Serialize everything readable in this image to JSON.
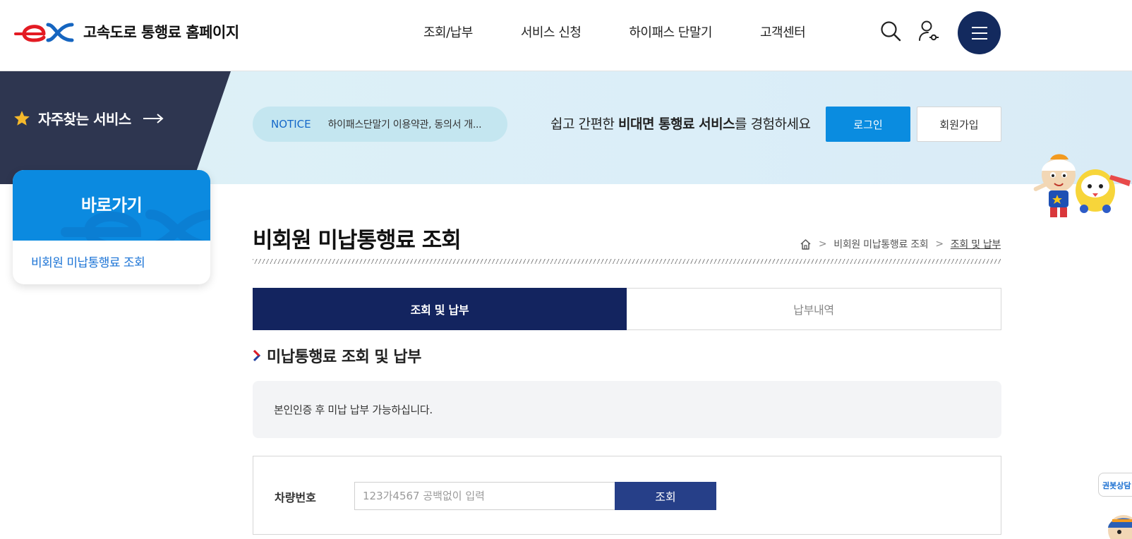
{
  "header": {
    "site_title": "고속도로 통행료 홈페이지",
    "nav": [
      "조회/납부",
      "서비스 신청",
      "하이패스 단말기",
      "고객센터"
    ]
  },
  "banner": {
    "favorites_label": "자주찾는 서비스",
    "notice_tag": "NOTICE",
    "notice_text": "하이패스단말기 이용약관, 동의서 개...",
    "promo_pre": "쉽고 간편한 ",
    "promo_bold": "비대면 통행료 서비스",
    "promo_post": "를 경험하세요",
    "login_label": "로그인",
    "join_label": "회원가입"
  },
  "quick": {
    "title": "바로가기",
    "link": "비회원 미납통행료 조회"
  },
  "page": {
    "title": "비회원 미납통행료 조회",
    "breadcrumb": [
      "비회원 미납통행료 조회",
      "조회 및 납부"
    ]
  },
  "tabs": [
    {
      "label": "조회 및 납부",
      "active": true
    },
    {
      "label": "납부내역",
      "active": false
    }
  ],
  "section": {
    "title": "미납통행료 조회 및 납부",
    "info": "본인인증 후 미납 납부 가능하십니다."
  },
  "form": {
    "label": "차량번호",
    "placeholder": "123가4567 공백없이 입력",
    "value": "",
    "submit_label": "조회"
  },
  "side_badge": "권봇상담",
  "colors": {
    "primary_blue": "#0b8ae0",
    "navy": "#13245f",
    "dark_slate": "#2e3650",
    "button_navy": "#263f88",
    "logo_red": "#e31b23"
  },
  "icons": [
    "search-icon",
    "user-icon",
    "menu-icon",
    "star-icon",
    "arrow-right-icon",
    "home-icon",
    "chevron-right-icon"
  ]
}
